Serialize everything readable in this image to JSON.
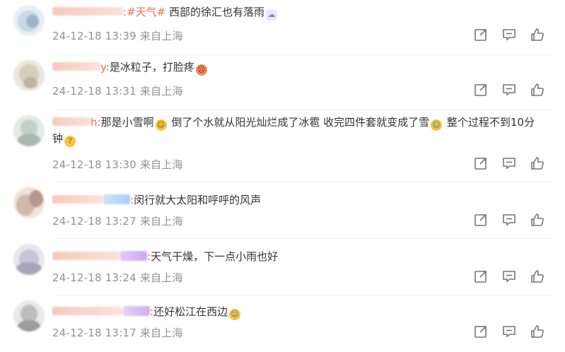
{
  "comments": [
    {
      "username_suffix": ":",
      "topic": "#天气#",
      "text": " 西部的徐汇也有落雨",
      "time": "24-12-18 13:39",
      "location": "来自上海",
      "emoji": "rain-cloud-emoji"
    },
    {
      "username_suffix": "y:",
      "text": "是冰粒子，打脸疼",
      "time": "24-12-18 13:31",
      "location": "来自上海",
      "emoji": "angry-face-emoji"
    },
    {
      "username_suffix": "h:",
      "text_a": "那是小雪啊",
      "text_b": " 倒了个水就从阳光灿烂成了冰雹 收完四件套就变成了雪",
      "text_c": " 整个过程不到10分钟",
      "time": "24-12-18 13:30",
      "location": "来自上海"
    },
    {
      "username_suffix": ":",
      "text": "闵行就大太阳和呼呼的风声",
      "time": "24-12-18 13:27",
      "location": "来自上海"
    },
    {
      "username_suffix": ":",
      "text": "天气干燥，下一点小雨也好",
      "time": "24-12-18 13:24",
      "location": "来自上海"
    },
    {
      "username_suffix": ":",
      "text": "还好松江在西边",
      "time": "24-12-18 13:17",
      "location": "来自上海"
    }
  ],
  "icons": [
    "share-icon",
    "comment-icon",
    "like-icon"
  ],
  "colors": {
    "username": "#eb7350",
    "meta": "#939393",
    "text": "#333333",
    "icon": "#777777"
  }
}
